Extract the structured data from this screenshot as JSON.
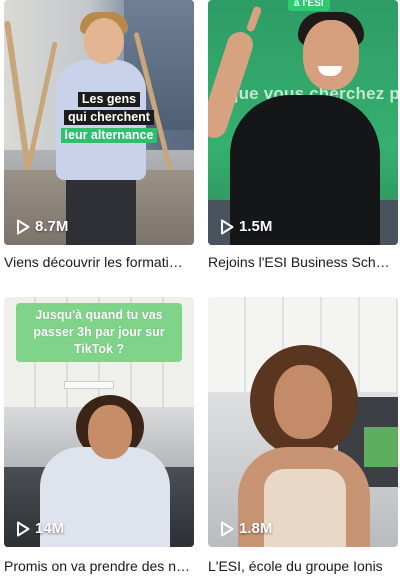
{
  "videos": [
    {
      "views": "8.7M",
      "caption": "Viens découvrir les formations ESI",
      "overlay_lines": [
        "Les gens",
        "qui cherchent",
        "leur alternance"
      ]
    },
    {
      "views": "1.5M",
      "caption": "Rejoins l'ESI Business School",
      "screen_text": "que vous cherchez p",
      "tag": "à l'ESI"
    },
    {
      "views": "14M",
      "caption": "Promis on va prendre des nouvelles",
      "bubble_text": "Jusqu'à quand tu vas passer 3h par jour sur TikTok ?"
    },
    {
      "views": "1.8M",
      "caption": "L'ESI, école du groupe Ionis"
    }
  ],
  "colors": {
    "text": "#161823",
    "highlight_green": "#2fbf6d",
    "bubble_green": "#7fd48a"
  },
  "icons": {
    "views": "play-icon"
  }
}
